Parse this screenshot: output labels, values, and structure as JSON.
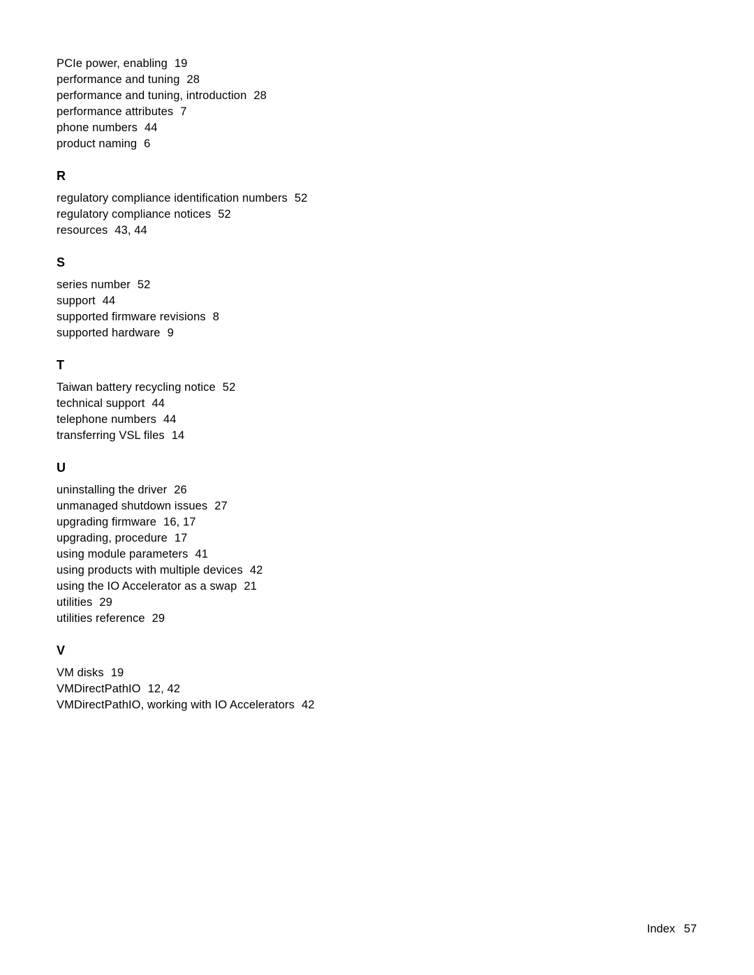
{
  "groups": [
    {
      "heading": null,
      "entries": [
        {
          "term": "PCIe power, enabling",
          "pages": "19"
        },
        {
          "term": "performance and tuning",
          "pages": "28"
        },
        {
          "term": "performance and tuning, introduction",
          "pages": "28"
        },
        {
          "term": "performance attributes",
          "pages": "7"
        },
        {
          "term": "phone numbers",
          "pages": "44"
        },
        {
          "term": "product naming",
          "pages": "6"
        }
      ]
    },
    {
      "heading": "R",
      "entries": [
        {
          "term": "regulatory compliance identification numbers",
          "pages": "52"
        },
        {
          "term": "regulatory compliance notices",
          "pages": "52"
        },
        {
          "term": "resources",
          "pages": "43, 44"
        }
      ]
    },
    {
      "heading": "S",
      "entries": [
        {
          "term": "series number",
          "pages": "52"
        },
        {
          "term": "support",
          "pages": "44"
        },
        {
          "term": "supported firmware revisions",
          "pages": "8"
        },
        {
          "term": "supported hardware",
          "pages": "9"
        }
      ]
    },
    {
      "heading": "T",
      "entries": [
        {
          "term": "Taiwan battery recycling notice",
          "pages": "52"
        },
        {
          "term": "technical support",
          "pages": "44"
        },
        {
          "term": "telephone numbers",
          "pages": "44"
        },
        {
          "term": "transferring VSL files",
          "pages": "14"
        }
      ]
    },
    {
      "heading": "U",
      "entries": [
        {
          "term": "uninstalling the driver",
          "pages": "26"
        },
        {
          "term": "unmanaged shutdown issues",
          "pages": "27"
        },
        {
          "term": "upgrading firmware",
          "pages": "16, 17"
        },
        {
          "term": "upgrading, procedure",
          "pages": "17"
        },
        {
          "term": "using module parameters",
          "pages": "41"
        },
        {
          "term": "using products with multiple devices",
          "pages": "42"
        },
        {
          "term": "using the IO Accelerator as a swap",
          "pages": "21"
        },
        {
          "term": "utilities",
          "pages": "29"
        },
        {
          "term": "utilities reference",
          "pages": "29"
        }
      ]
    },
    {
      "heading": "V",
      "entries": [
        {
          "term": "VM disks",
          "pages": "19"
        },
        {
          "term": "VMDirectPathIO",
          "pages": "12, 42"
        },
        {
          "term": "VMDirectPathIO, working with IO Accelerators",
          "pages": "42"
        }
      ]
    }
  ],
  "footer": {
    "label": "Index",
    "page": "57"
  }
}
